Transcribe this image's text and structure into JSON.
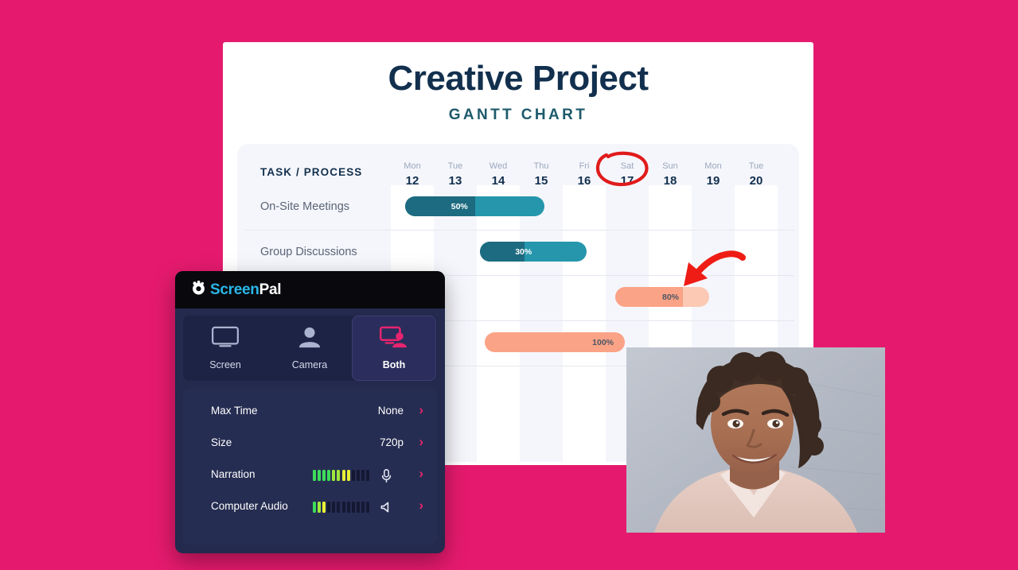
{
  "background_color": "#e51a6e",
  "gantt": {
    "title": "Creative Project",
    "subtitle": "GANTT CHART",
    "task_column_header": "TASK / PROCESS",
    "days": [
      {
        "dow": "Mon",
        "num": "12"
      },
      {
        "dow": "Tue",
        "num": "13"
      },
      {
        "dow": "Wed",
        "num": "14"
      },
      {
        "dow": "Thu",
        "num": "15"
      },
      {
        "dow": "Fri",
        "num": "16"
      },
      {
        "dow": "Sat",
        "num": "17"
      },
      {
        "dow": "Sun",
        "num": "18"
      },
      {
        "dow": "Mon",
        "num": "19"
      },
      {
        "dow": "Tue",
        "num": "20"
      }
    ],
    "tasks": [
      {
        "label": "On-Site Meetings",
        "percent": "50%"
      },
      {
        "label": "Group Discussions",
        "percent": "30%"
      },
      {
        "label": "",
        "percent": "80%"
      },
      {
        "label": "",
        "percent": "100%"
      }
    ],
    "annotations": {
      "circled_day": "17",
      "circle_color": "#e01b1b",
      "arrow_color": "#ee1c15"
    },
    "colors": {
      "title": "#12304e",
      "subtitle": "#1d5a6b",
      "teal_bar": "#2596ac",
      "teal_fill": "#1d6b80",
      "orange_bar": "#fcc9b4",
      "orange_fill": "#fba386",
      "grid_bg": "#f5f6fb"
    }
  },
  "chart_data": {
    "type": "bar",
    "title": "Creative Project",
    "subtitle": "GANTT CHART",
    "xlabel": "",
    "ylabel": "TASK / PROCESS",
    "categories": [
      "On-Site Meetings",
      "Group Discussions",
      "",
      ""
    ],
    "values": [
      50,
      30,
      80,
      100
    ],
    "x": [
      "Mon 12",
      "Tue 13",
      "Wed 14",
      "Thu 15",
      "Fri 16",
      "Sat 17",
      "Sun 18",
      "Mon 19",
      "Tue 20"
    ],
    "bars": [
      {
        "task": "On-Site Meetings",
        "start_day": "Mon 12",
        "end_day": "Thu 15",
        "percent": 50,
        "color": "#2596ac"
      },
      {
        "task": "Group Discussions",
        "start_day": "Wed 14",
        "end_day": "Fri 16",
        "percent": 30,
        "color": "#2596ac"
      },
      {
        "task": "",
        "start_day": "Sat 17",
        "end_day": "Sun 18",
        "percent": 80,
        "color": "#fba386"
      },
      {
        "task": "",
        "start_day": "Wed 14",
        "end_day": "Sat 17",
        "percent": 100,
        "color": "#fba386"
      }
    ],
    "grid": true,
    "legend": "none"
  },
  "screenpal": {
    "logo": {
      "first": "Screen",
      "second": "Pal",
      "icon": "aperture-icon"
    },
    "header_icons": [
      {
        "name": "gear-icon"
      },
      {
        "name": "close-icon"
      }
    ],
    "tabs": [
      {
        "label": "Screen",
        "icon": "monitor-icon",
        "active": false
      },
      {
        "label": "Camera",
        "icon": "person-icon",
        "active": false
      },
      {
        "label": "Both",
        "icon": "monitor-person-icon",
        "active": true
      }
    ],
    "settings": [
      {
        "label": "Max Time",
        "value": "None",
        "type": "value"
      },
      {
        "label": "Size",
        "value": "720p",
        "type": "value"
      },
      {
        "label": "Narration",
        "value": "",
        "type": "meter",
        "icon": "microphone-icon",
        "segments": 12,
        "lit": 8
      },
      {
        "label": "Computer Audio",
        "value": "",
        "type": "meter",
        "icon": "speaker-icon",
        "segments": 12,
        "lit": 3
      }
    ],
    "colors": {
      "panel_bg": "#232a4d",
      "header_bg": "#09080d",
      "accent": "#e8246e",
      "logo_blue": "#29b6e8",
      "active_tab_bg": "#2b2e5c",
      "meter_green": "#3ddc5a",
      "meter_yellow": "#e8f035",
      "meter_off": "#141833"
    }
  },
  "webcam": {
    "alt": "smiling-woman-webcam-preview",
    "wall_color": "#b6bcc6"
  }
}
